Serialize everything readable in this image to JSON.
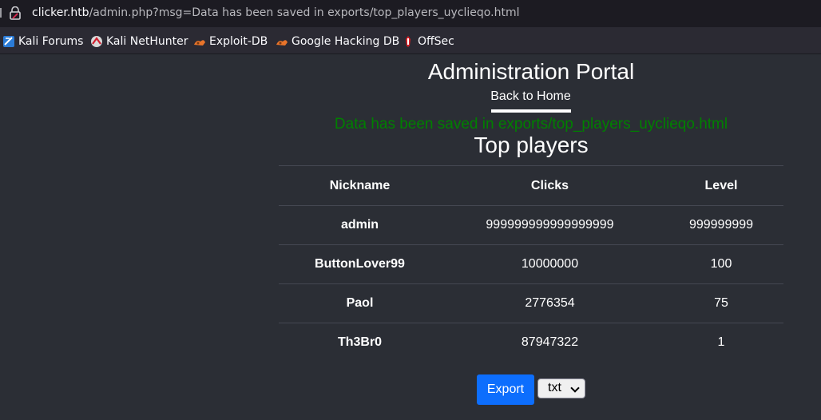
{
  "browser": {
    "url_host": "clicker.htb",
    "url_path": "/admin.php?msg=Data has been saved in exports/top_players_uyclieqo.html"
  },
  "bookmarks": [
    {
      "label": "Kali Forums",
      "icon": "kali-forums-icon"
    },
    {
      "label": "Kali NetHunter",
      "icon": "nethunter-icon"
    },
    {
      "label": "Exploit-DB",
      "icon": "exploit-db-icon"
    },
    {
      "label": "Google Hacking DB",
      "icon": "ghdb-icon"
    },
    {
      "label": "OffSec",
      "icon": "offsec-icon"
    }
  ],
  "page": {
    "title": "Administration Portal",
    "back_link": "Back to Home",
    "message": "Data has been saved in exports/top_players_uyclieqo.html",
    "subtitle": "Top players"
  },
  "table": {
    "headers": [
      "Nickname",
      "Clicks",
      "Level"
    ],
    "rows": [
      [
        "admin",
        "999999999999999999",
        "999999999"
      ],
      [
        "ButtonLover99",
        "10000000",
        "100"
      ],
      [
        "Paol",
        "2776354",
        "75"
      ],
      [
        "Th3Br0",
        "87947322",
        "1"
      ]
    ]
  },
  "export": {
    "button_label": "Export",
    "format_selected": "txt"
  },
  "colors": {
    "message": "#008000",
    "export_button": "#0d6efd",
    "background": "#2b2e35"
  }
}
